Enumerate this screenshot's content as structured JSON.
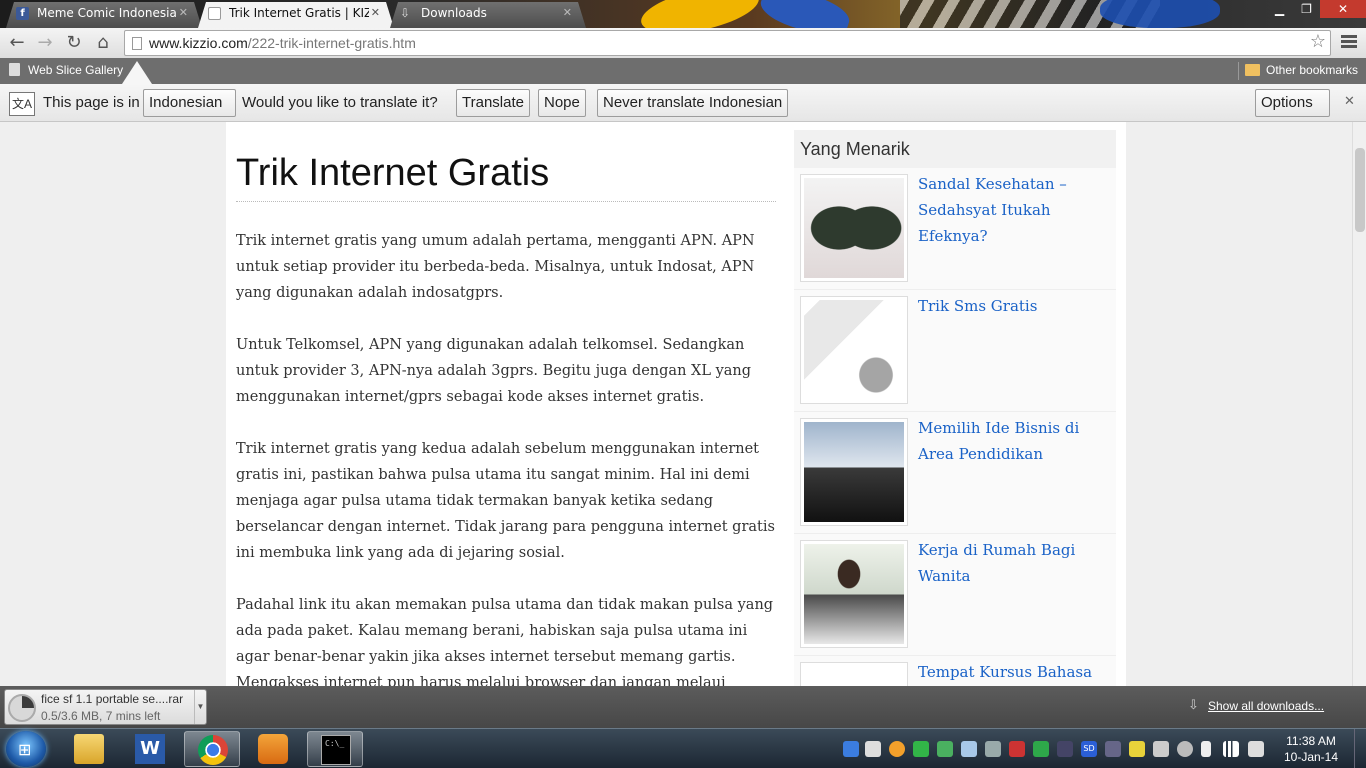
{
  "browser": {
    "tabs": [
      {
        "label": "Meme Comic Indonesia",
        "icon": "facebook-icon",
        "active": false
      },
      {
        "label": "Trik Internet Gratis | KIZZIO",
        "icon": "page-icon",
        "active": true
      },
      {
        "label": "Downloads",
        "icon": "download-icon",
        "active": false
      }
    ],
    "window_controls": {
      "minimize": "▁",
      "restore": "❐",
      "close": "✕"
    },
    "url_domain": "www.kizzio.com",
    "url_path": "/222-trik-internet-gratis.htm",
    "bookmarks": {
      "left": "Web Slice Gallery",
      "right": "Other bookmarks"
    },
    "translate_bar": {
      "prefix": "This page is in",
      "language": "Indonesian",
      "question": "Would you like to translate it?",
      "translate": "Translate",
      "nope": "Nope",
      "never": "Never translate Indonesian",
      "options": "Options"
    }
  },
  "article": {
    "title": "Trik Internet Gratis",
    "paragraphs": [
      "Trik internet gratis yang umum adalah pertama, mengganti APN. APN untuk setiap provider itu berbeda-beda. Misalnya, untuk Indosat, APN yang digunakan adalah indosatgprs.",
      "Untuk Telkomsel, APN yang digunakan adalah telkomsel. Sedangkan untuk provider 3, APN-nya adalah 3gprs. Begitu juga dengan XL yang menggunakan internet/gprs sebagai kode akses internet gratis.",
      "Trik internet gratis yang kedua adalah sebelum menggunakan internet gratis ini, pastikan bahwa pulsa utama itu sangat minim. Hal ini demi menjaga agar pulsa utama tidak termakan banyak ketika sedang berselancar dengan internet. Tidak jarang para pengguna internet gratis ini membuka link yang ada di jejaring sosial.",
      "Padahal link itu akan memakan pulsa utama dan tidak makan pulsa yang ada pada paket. Kalau memang berani, habiskan saja pulsa utama ini agar benar-benar yakin jika akses internet tersebut memang gartis. Mengakses internet pun harus melalui browser dan jangan melaui aplikasi."
    ]
  },
  "sidebar": {
    "title": "Yang Menarik",
    "items": [
      {
        "label": "Sandal Kesehatan – Sedahsyat Itukah Efeknya?",
        "image": "sandals-image"
      },
      {
        "label": "Trik Sms Gratis",
        "image": "sms-image"
      },
      {
        "label": "Memilih Ide Bisnis di Area Pendidikan",
        "image": "business-image"
      },
      {
        "label": "Kerja di Rumah Bagi Wanita",
        "image": "work-at-home-image"
      },
      {
        "label": "Tempat Kursus Bahasa",
        "image": "course-image"
      }
    ]
  },
  "downloads": {
    "file": "fice sf 1.1 portable se....rar",
    "status": "0.5/3.6 MB, 7 mins left",
    "show_all": "Show all downloads..."
  },
  "taskbar": {
    "time": "11:38 AM",
    "date": "10-Jan-14",
    "apps": [
      "explorer",
      "word",
      "chrome",
      "media-player",
      "cmd"
    ]
  },
  "colors": {
    "link": "#1a62c7",
    "bookmark_bar": "#6e6e6e",
    "taskbar": "#1c2733"
  }
}
